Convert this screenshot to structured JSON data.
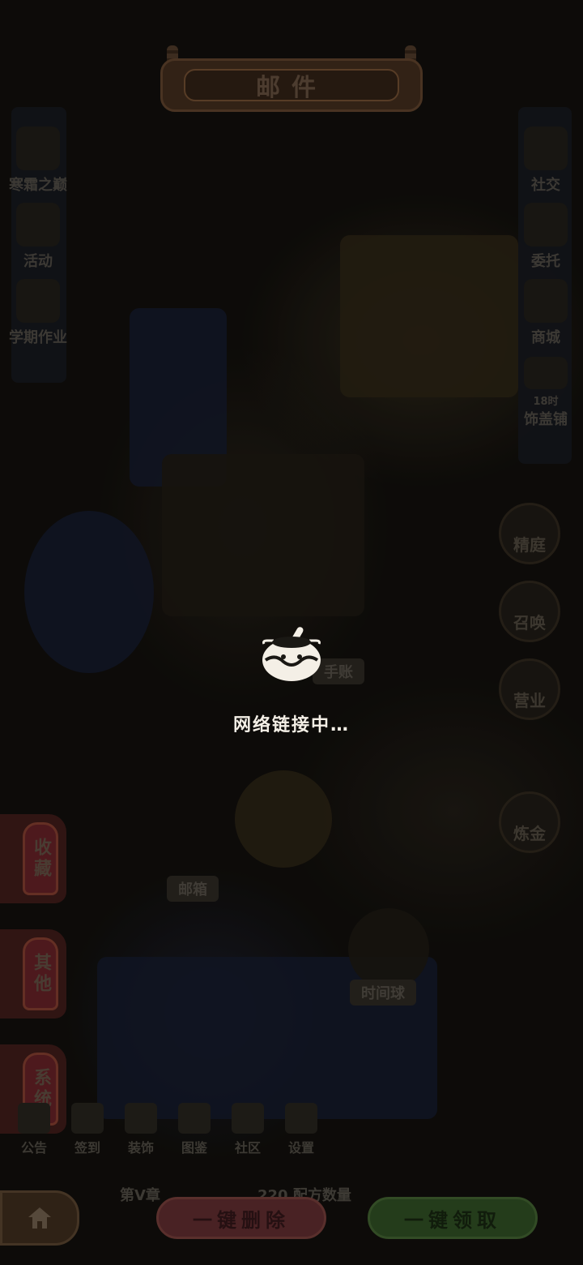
{
  "header": {
    "title": "邮件"
  },
  "left_menu": [
    {
      "label": "寒霜之巅",
      "icon": "snow-peak-icon"
    },
    {
      "label": "活动",
      "icon": "event-icon"
    },
    {
      "label": "学期作业",
      "icon": "homework-icon"
    }
  ],
  "right_menu": [
    {
      "label": "社交",
      "icon": "social-icon"
    },
    {
      "label": "委托",
      "icon": "commission-icon"
    },
    {
      "label": "商城",
      "icon": "shop-icon"
    },
    {
      "label": "饰盖铺",
      "badge": "18时",
      "icon": "store-icon"
    }
  ],
  "right_circles": [
    {
      "label": "精庭"
    },
    {
      "label": "召唤"
    },
    {
      "label": "营业"
    },
    {
      "label": "炼金"
    }
  ],
  "world_labels": {
    "handbook": "手账",
    "mailbox": "邮箱",
    "time_ball": "时间球"
  },
  "mail_tabs": [
    {
      "label": "收藏"
    },
    {
      "label": "其他"
    },
    {
      "label": "系统"
    }
  ],
  "bottom_nav": [
    {
      "label": "公告",
      "icon": "notice-icon"
    },
    {
      "label": "签到",
      "icon": "checkin-icon"
    },
    {
      "label": "装饰",
      "icon": "decor-icon"
    },
    {
      "label": "图鉴",
      "icon": "codex-icon"
    },
    {
      "label": "社区",
      "icon": "community-icon"
    },
    {
      "label": "设置",
      "icon": "settings-icon"
    }
  ],
  "info_bar": {
    "chapter": "第V章",
    "recipe_count": "220 配方数量"
  },
  "actions": {
    "delete_all": "一键删除",
    "collect_all": "一键领取"
  },
  "loading": {
    "text": "网络链接中…",
    "icon": "cauldron-icon"
  }
}
